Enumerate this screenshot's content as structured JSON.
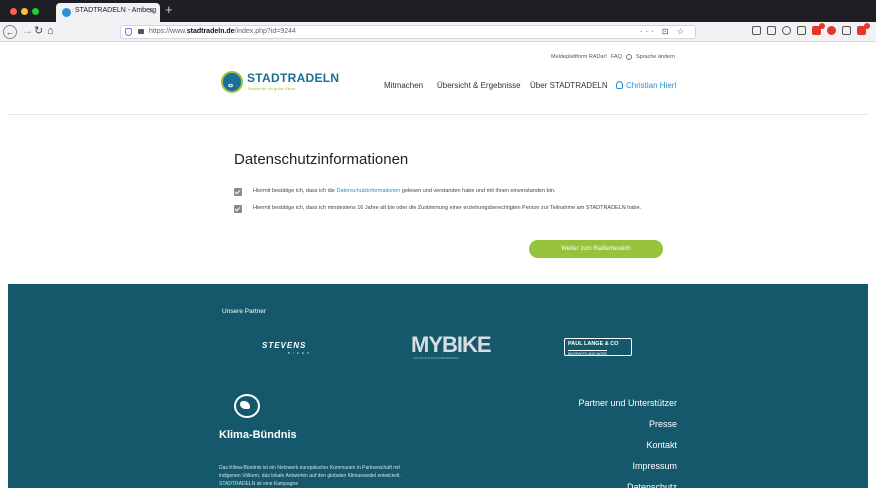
{
  "browser": {
    "tab_title": "STADTRADELN - Amberg",
    "tab_close": "×",
    "new_tab": "+",
    "url_prefix": "https://www.",
    "url_domain": "stadtradeln.de",
    "url_path": "/index.php?id=9244",
    "url_actions": "··· ⊡ ☆"
  },
  "header": {
    "util_links": {
      "reporting": "Meldeplattform RADar!",
      "faq": "FAQ",
      "language": "Sprache ändern"
    },
    "logo": {
      "name": "STADTRADELN",
      "claim": "Radeln für ein gutes Klima"
    },
    "nav": [
      "Mitmachen",
      "Übersicht & Ergebnisse",
      "Über STADTRADELN"
    ],
    "user": "Christian Hierl"
  },
  "content": {
    "title": "Datenschutzinformationen",
    "check1_before": "Hiermit bestätige ich, dass ich die ",
    "check1_link": "Datenschutzinformationen",
    "check1_after": " gelesen und verstanden habe und mit ihnen einverstanden bin.",
    "check2": "Hiermit bestätige ich, dass ich mindestens 16 Jahre alt bin oder die Zustimmung einer erziehungsberechtigten Person zur Teilnahme am STADTRADELN habe.",
    "cta": "Weiter zum Radlerbereich"
  },
  "footer": {
    "partners_heading": "Unsere Partner",
    "partners": {
      "stevens": "STEVENS",
      "stevens_sub": "BIKES",
      "mybike": "MYBIKE",
      "mybike_sub": "DAS MAGAZIN FÜR FAHRRADFAHRER",
      "paul_top": "PAUL LANGE & CO",
      "paul_bottom": "BIKEPARTS AND MORE"
    },
    "klima_name": "Klima-Bündnis",
    "klima_text": "Das Klima-Bündnis ist ein Netzwerk europäischer Kommunen in Partnerschaft mit indigenen Völkern, das lokale Antworten auf den globalen Klimawandel entwickelt. STADTRADELN ist eine Kampagne",
    "links": [
      "Partner und Unterstützer",
      "Presse",
      "Kontakt",
      "Impressum",
      "Datenschutz"
    ]
  },
  "colors": {
    "brand_blue": "#1a6f95",
    "brand_green": "#97c23c",
    "footer_bg": "#16586b",
    "link_blue": "#2a8fd3"
  }
}
